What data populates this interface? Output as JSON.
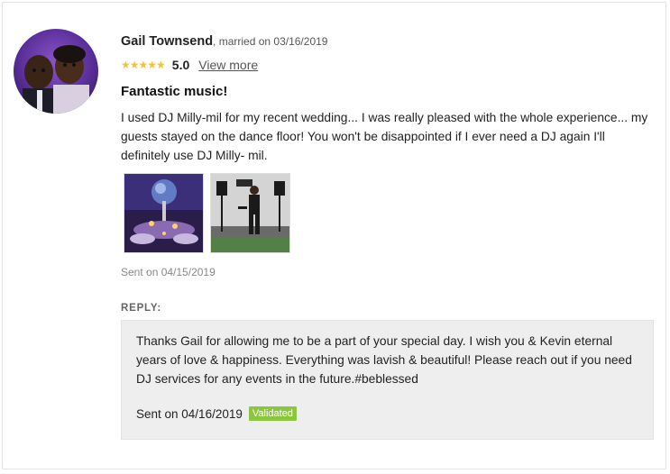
{
  "reviewer": {
    "name": "Gail Townsend",
    "married_text": ", married on 03/16/2019"
  },
  "rating": {
    "stars": "★★★★★",
    "score": "5.0",
    "view_more": "View more"
  },
  "review": {
    "title": "Fantastic music!",
    "body": "I used DJ Milly-mil for my recent wedding... I was really pleased with the whole experience... my guests stayed on the dance floor! You won't be disappointed if I ever need a DJ again I'll definitely use DJ Milly- mil.",
    "sent": "Sent on 04/15/2019"
  },
  "reply": {
    "label": "REPLY:",
    "text": "Thanks Gail for allowing me to be a part of your special day. I wish you & Kevin eternal years of love & happiness. Everything was lavish & beautiful! Please reach out if you need DJ services for any events in the future.#beblessed",
    "sent": "Sent on 04/16/2019",
    "badge": "Validated"
  },
  "colors": {
    "star": "#f4c430",
    "badge": "#8cc63f",
    "reply_bg": "#eeeeee"
  }
}
